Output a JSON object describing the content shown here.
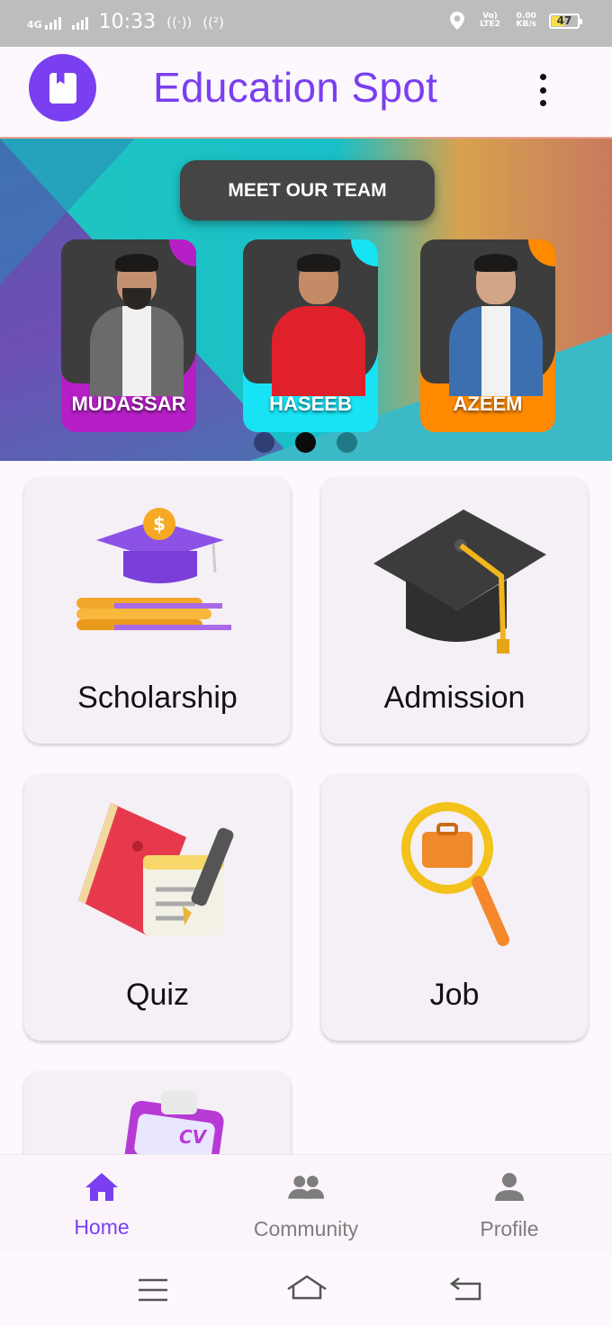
{
  "status_bar": {
    "network_left": "4G",
    "time": "10:33",
    "network_right": "Vo) LTE2",
    "data_speed_value": "0.00",
    "data_speed_unit": "KB/s",
    "battery_level": "47"
  },
  "app_bar": {
    "title": "Education Spot"
  },
  "banner": {
    "heading": "MEET OUR TEAM",
    "members": [
      {
        "name": "MUDASSAR"
      },
      {
        "name": "HASEEB"
      },
      {
        "name": "AZEEM"
      }
    ],
    "active_page": 2,
    "page_count": 3
  },
  "categories": [
    {
      "label": "Scholarship",
      "icon": "scholarship-icon"
    },
    {
      "label": "Admission",
      "icon": "graduation-cap-icon"
    },
    {
      "label": "Quiz",
      "icon": "quiz-notebook-icon"
    },
    {
      "label": "Job",
      "icon": "job-search-icon"
    },
    {
      "label": "CV",
      "icon": "cv-clipboard-icon"
    }
  ],
  "bottom_nav": {
    "items": [
      {
        "label": "Home",
        "icon": "home-icon",
        "active": true
      },
      {
        "label": "Community",
        "icon": "community-icon",
        "active": false
      },
      {
        "label": "Profile",
        "icon": "profile-icon",
        "active": false
      }
    ],
    "active_color": "#7a3ff0",
    "inactive_color": "#7d7d7d"
  },
  "colors": {
    "accent": "#7a3ff0",
    "card_bg": "#f5eff6"
  }
}
